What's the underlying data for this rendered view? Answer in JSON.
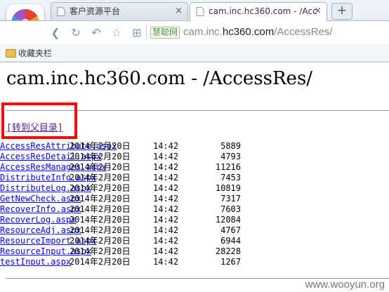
{
  "browser": {
    "tabs": [
      {
        "title": "客户资源平台",
        "active": false
      },
      {
        "title": "cam.inc.hc360.com - /Acc",
        "active": true
      }
    ],
    "tab_close_glyph": "×",
    "new_tab_glyph": "+",
    "addressbar": {
      "brand": "慧聪网",
      "url_prefix": "cam.inc.",
      "url_host": "hc360.com",
      "url_path": "/AccessRes/"
    },
    "bookmarks_bar": {
      "folder_label": "收藏夹栏"
    }
  },
  "page": {
    "title": "cam.inc.hc360.com - /AccessRes/",
    "parent_link": "[转到父目录]",
    "files": [
      {
        "date": "2014年2月20日",
        "time": "14:42",
        "size": "5889",
        "name": "AccessResAttribute.aspx"
      },
      {
        "date": "2014年2月20日",
        "time": "14:42",
        "size": "4793",
        "name": "AccessResDetail.aspx"
      },
      {
        "date": "2014年2月20日",
        "time": "14:42",
        "size": "11216",
        "name": "AccessResManages.aspx"
      },
      {
        "date": "2014年2月20日",
        "time": "14:42",
        "size": "7453",
        "name": "DistributeInfo.aspx"
      },
      {
        "date": "2014年2月20日",
        "time": "14:42",
        "size": "10819",
        "name": "DistributeLog.aspx"
      },
      {
        "date": "2014年2月20日",
        "time": "14:42",
        "size": "7317",
        "name": "GetNewCheck.aspx"
      },
      {
        "date": "2014年2月20日",
        "time": "14:42",
        "size": "7603",
        "name": "RecoverInfo.aspx"
      },
      {
        "date": "2014年2月20日",
        "time": "14:42",
        "size": "12084",
        "name": "RecoverLog.aspx"
      },
      {
        "date": "2014年2月20日",
        "time": "14:42",
        "size": "4767",
        "name": "ResourceAdj.aspx"
      },
      {
        "date": "2014年2月20日",
        "time": "14:42",
        "size": "6944",
        "name": "ResourceImport.aspx"
      },
      {
        "date": "2014年2月20日",
        "time": "14:42",
        "size": "28228",
        "name": "ResourceInput.aspx"
      },
      {
        "date": "2014年2月20日",
        "time": "14:42",
        "size": "1267",
        "name": "testInput.aspx"
      }
    ],
    "watermark": "www.wooyun.org"
  },
  "colors": {
    "highlight_box": "#ff0000",
    "link": "#0000ee",
    "visited_link": "#551a8b"
  },
  "icons": [
    "browser-logo-icon",
    "page-favicon-icon",
    "back-icon",
    "refresh-icon",
    "undo-icon",
    "star-icon",
    "grid-icon",
    "folder-icon"
  ]
}
